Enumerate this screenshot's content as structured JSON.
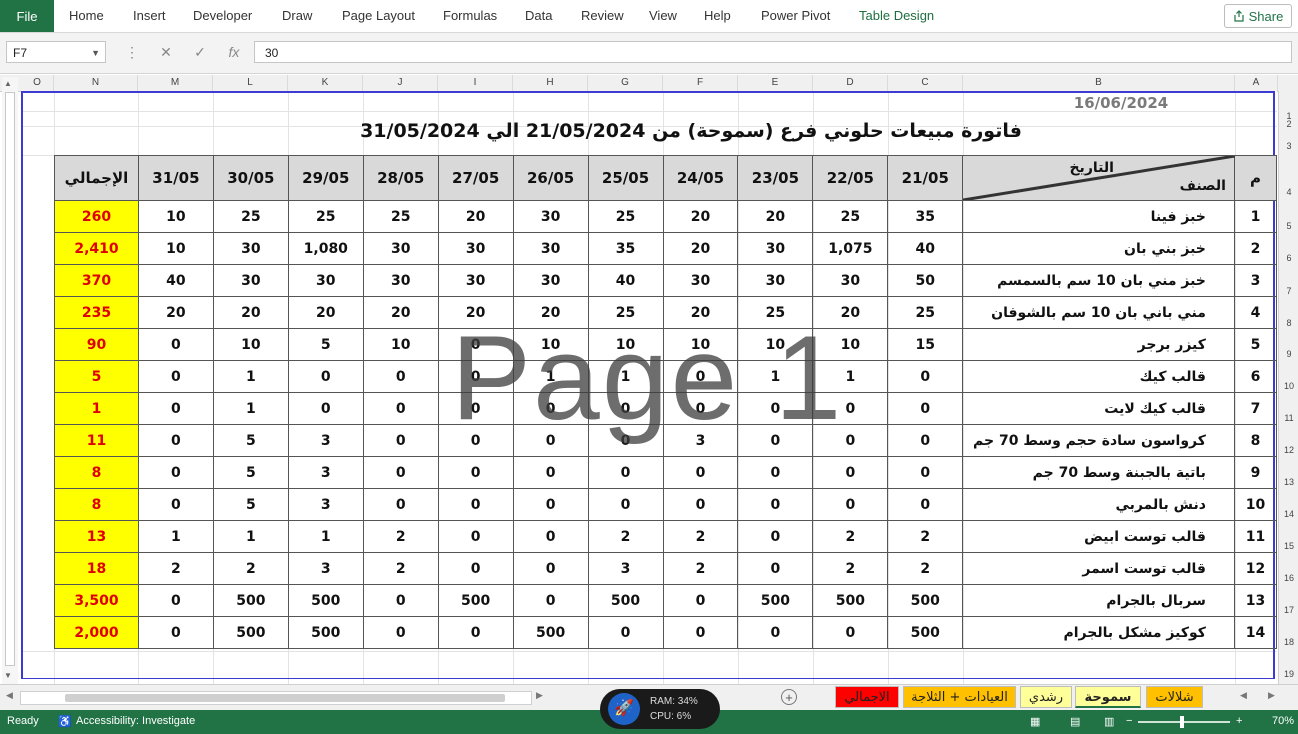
{
  "ribbon": {
    "file": "File",
    "tabs": [
      "Home",
      "Insert",
      "Developer",
      "Draw",
      "Page Layout",
      "Formulas",
      "Data",
      "Review",
      "View",
      "Help",
      "Power Pivot",
      "Table Design"
    ],
    "share": "Share"
  },
  "formula_bar": {
    "name_box": "F7",
    "cancel_icon": "✕",
    "enter_icon": "✓",
    "fx_icon": "fx",
    "value": "30"
  },
  "columns": [
    "O",
    "N",
    "M",
    "L",
    "K",
    "J",
    "I",
    "H",
    "G",
    "F",
    "E",
    "D",
    "C",
    "B",
    "A"
  ],
  "rows": [
    "1",
    "2",
    "3",
    "4",
    "5",
    "6",
    "7",
    "8",
    "9",
    "10",
    "11",
    "12",
    "13",
    "14",
    "15",
    "16",
    "17",
    "18",
    "19"
  ],
  "sheet": {
    "date": "16/06/2024",
    "title": "فاتورة مبيعات حلوني            فرع (سموحة) من 21/05/2024 الي 31/05/2024",
    "header": {
      "num": "م",
      "date_label": "التاريخ",
      "item_label": "الصنف",
      "dates": [
        "21/05",
        "22/05",
        "23/05",
        "24/05",
        "25/05",
        "26/05",
        "27/05",
        "28/05",
        "29/05",
        "30/05",
        "31/05"
      ],
      "total": "الإجمالي"
    },
    "items": [
      {
        "num": "1",
        "name": "خبز فينا",
        "values": [
          "35",
          "25",
          "20",
          "20",
          "25",
          "30",
          "20",
          "25",
          "25",
          "25",
          "10"
        ],
        "total": "260"
      },
      {
        "num": "2",
        "name": "خبز بني بان",
        "values": [
          "40",
          "1,075",
          "30",
          "20",
          "35",
          "30",
          "30",
          "30",
          "1,080",
          "30",
          "10"
        ],
        "total": "2,410"
      },
      {
        "num": "3",
        "name": "خبز مني بان 10 سم بالسمسم",
        "values": [
          "50",
          "30",
          "30",
          "30",
          "40",
          "30",
          "30",
          "30",
          "30",
          "30",
          "40"
        ],
        "total": "370"
      },
      {
        "num": "4",
        "name": "مني باني بان 10 سم بالشوفان",
        "values": [
          "25",
          "20",
          "25",
          "20",
          "25",
          "20",
          "20",
          "20",
          "20",
          "20",
          "20"
        ],
        "total": "235"
      },
      {
        "num": "5",
        "name": "كيزر برجر",
        "values": [
          "15",
          "10",
          "10",
          "10",
          "10",
          "10",
          "0",
          "10",
          "5",
          "10",
          "0"
        ],
        "total": "90"
      },
      {
        "num": "6",
        "name": "قالب كيك",
        "values": [
          "0",
          "1",
          "1",
          "0",
          "1",
          "1",
          "0",
          "0",
          "0",
          "1",
          "0"
        ],
        "total": "5"
      },
      {
        "num": "7",
        "name": "قالب كيك لايت",
        "values": [
          "0",
          "0",
          "0",
          "0",
          "0",
          "0",
          "0",
          "0",
          "0",
          "1",
          "0"
        ],
        "total": "1"
      },
      {
        "num": "8",
        "name": "كرواسون سادة حجم وسط 70 جم",
        "values": [
          "0",
          "0",
          "0",
          "3",
          "0",
          "0",
          "0",
          "0",
          "3",
          "5",
          "0"
        ],
        "total": "11"
      },
      {
        "num": "9",
        "name": "باتية بالجبنة وسط 70 جم",
        "values": [
          "0",
          "0",
          "0",
          "0",
          "0",
          "0",
          "0",
          "0",
          "3",
          "5",
          "0"
        ],
        "total": "8"
      },
      {
        "num": "10",
        "name": "دنش بالمربي",
        "values": [
          "0",
          "0",
          "0",
          "0",
          "0",
          "0",
          "0",
          "0",
          "3",
          "5",
          "0"
        ],
        "total": "8"
      },
      {
        "num": "11",
        "name": "قالب توست ابيض",
        "values": [
          "2",
          "2",
          "0",
          "2",
          "2",
          "0",
          "0",
          "2",
          "1",
          "1",
          "1"
        ],
        "total": "13"
      },
      {
        "num": "12",
        "name": "قالب توست اسمر",
        "values": [
          "2",
          "2",
          "0",
          "2",
          "3",
          "0",
          "0",
          "2",
          "3",
          "2",
          "2"
        ],
        "total": "18"
      },
      {
        "num": "13",
        "name": "سربال بالجرام",
        "values": [
          "500",
          "500",
          "500",
          "0",
          "500",
          "0",
          "500",
          "0",
          "500",
          "500",
          "0"
        ],
        "total": "3,500"
      },
      {
        "num": "14",
        "name": "كوكيز مشكل بالجرام",
        "values": [
          "500",
          "0",
          "0",
          "0",
          "0",
          "500",
          "0",
          "0",
          "500",
          "500",
          "0"
        ],
        "total": "2,000"
      }
    ],
    "watermark": "Page 1"
  },
  "sheet_tabs": [
    {
      "label": "شلالات",
      "color": "#ffc000",
      "active": false
    },
    {
      "label": "سموحة",
      "color": "#ffff99",
      "active": true
    },
    {
      "label": "رشدي",
      "color": "#ffff99",
      "active": false
    },
    {
      "label": "العيادات + الثلاجة",
      "color": "#ffc000",
      "active": false
    },
    {
      "label": "الاجمالي",
      "color": "#ff0000",
      "active": false
    }
  ],
  "status": {
    "ready": "Ready",
    "accessibility": "Accessibility: Investigate",
    "zoom": "70%"
  },
  "overlay": {
    "ram": "RAM: 34%",
    "cpu": "CPU: 6%"
  },
  "colors": {
    "excel_green": "#217346",
    "total_fill": "#ffff00",
    "total_text": "#e00000",
    "header_fill": "#d9d9d9",
    "page_border": "#3b3bd2"
  }
}
